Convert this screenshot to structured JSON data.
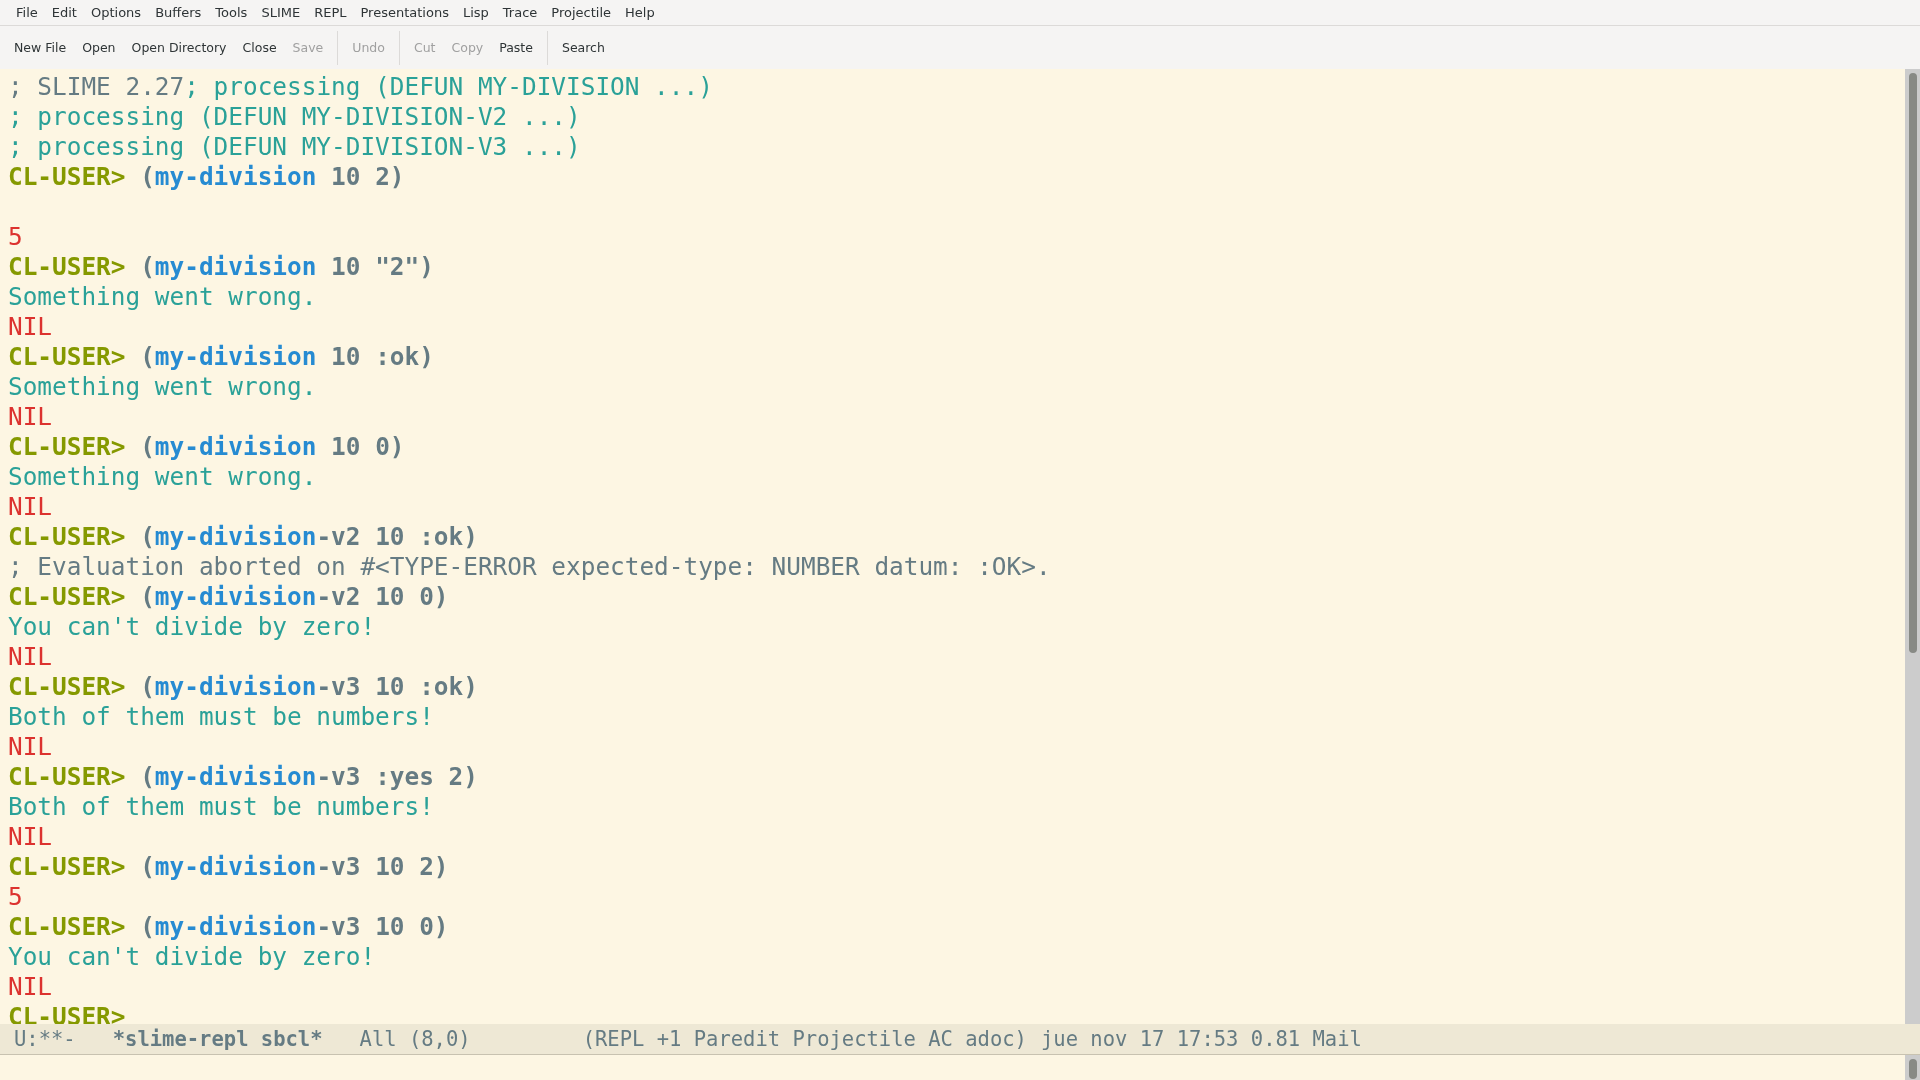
{
  "menu_bar": [
    "File",
    "Edit",
    "Options",
    "Buffers",
    "Tools",
    "SLIME",
    "REPL",
    "Presentations",
    "Lisp",
    "Trace",
    "Projectile",
    "Help"
  ],
  "toolbar": [
    [
      {
        "label": "New File",
        "disabled": false
      },
      {
        "label": "Open",
        "disabled": false
      },
      {
        "label": "Open Directory",
        "disabled": false
      },
      {
        "label": "Close",
        "disabled": false
      },
      {
        "label": "Save",
        "disabled": true
      }
    ],
    [
      {
        "label": "Undo",
        "disabled": true
      }
    ],
    [
      {
        "label": "Cut",
        "disabled": true
      },
      {
        "label": "Copy",
        "disabled": true
      },
      {
        "label": "Paste",
        "disabled": false
      }
    ],
    [
      {
        "label": "Search",
        "disabled": false
      }
    ]
  ],
  "repl_lines": [
    {
      "kind": "output",
      "spans": [
        {
          "kind": "comment",
          "text": "; SLIME 2.27"
        },
        {
          "kind": "message",
          "text": "; processing (DEFUN MY-DIVISION ...)"
        }
      ]
    },
    {
      "kind": "output",
      "spans": [
        {
          "kind": "message",
          "text": "; processing (DEFUN MY-DIVISION-V2 ...)"
        }
      ]
    },
    {
      "kind": "output",
      "spans": [
        {
          "kind": "message",
          "text": "; processing (DEFUN MY-DIVISION-V3 ...)"
        }
      ]
    },
    {
      "kind": "input",
      "spans": [
        {
          "kind": "prompt",
          "text": "CL-USER>"
        },
        {
          "kind": "paren",
          "text": " ("
        },
        {
          "kind": "function",
          "text": "my-division"
        },
        {
          "kind": "code",
          "text": " 10 2)"
        }
      ]
    },
    {
      "kind": "blank"
    },
    {
      "kind": "output",
      "spans": [
        {
          "kind": "value",
          "text": "5"
        }
      ]
    },
    {
      "kind": "input",
      "spans": [
        {
          "kind": "prompt",
          "text": "CL-USER>"
        },
        {
          "kind": "paren",
          "text": " ("
        },
        {
          "kind": "function",
          "text": "my-division"
        },
        {
          "kind": "code",
          "text": " 10 \"2\")"
        }
      ]
    },
    {
      "kind": "output",
      "spans": [
        {
          "kind": "message",
          "text": "Something went wrong."
        }
      ]
    },
    {
      "kind": "output",
      "spans": [
        {
          "kind": "value",
          "text": "NIL"
        }
      ]
    },
    {
      "kind": "input",
      "spans": [
        {
          "kind": "prompt",
          "text": "CL-USER>"
        },
        {
          "kind": "paren",
          "text": " ("
        },
        {
          "kind": "function",
          "text": "my-division"
        },
        {
          "kind": "code",
          "text": " 10 :ok)"
        }
      ]
    },
    {
      "kind": "output",
      "spans": [
        {
          "kind": "message",
          "text": "Something went wrong."
        }
      ]
    },
    {
      "kind": "output",
      "spans": [
        {
          "kind": "value",
          "text": "NIL"
        }
      ]
    },
    {
      "kind": "input",
      "spans": [
        {
          "kind": "prompt",
          "text": "CL-USER>"
        },
        {
          "kind": "paren",
          "text": " ("
        },
        {
          "kind": "function",
          "text": "my-division"
        },
        {
          "kind": "code",
          "text": " 10 0)"
        }
      ]
    },
    {
      "kind": "output",
      "spans": [
        {
          "kind": "message",
          "text": "Something went wrong."
        }
      ]
    },
    {
      "kind": "output",
      "spans": [
        {
          "kind": "value",
          "text": "NIL"
        }
      ]
    },
    {
      "kind": "input",
      "spans": [
        {
          "kind": "prompt",
          "text": "CL-USER>"
        },
        {
          "kind": "paren",
          "text": " ("
        },
        {
          "kind": "function",
          "text": "my-division"
        },
        {
          "kind": "code",
          "text": "-v2 10 :ok)"
        }
      ]
    },
    {
      "kind": "output",
      "spans": [
        {
          "kind": "comment",
          "text": "; Evaluation aborted on #<TYPE-ERROR expected-type: NUMBER datum: :OK>."
        }
      ]
    },
    {
      "kind": "input",
      "spans": [
        {
          "kind": "prompt",
          "text": "CL-USER>"
        },
        {
          "kind": "paren",
          "text": " ("
        },
        {
          "kind": "function",
          "text": "my-division"
        },
        {
          "kind": "code",
          "text": "-v2 10 0)"
        }
      ]
    },
    {
      "kind": "output",
      "spans": [
        {
          "kind": "message",
          "text": "You can't divide by zero!"
        }
      ]
    },
    {
      "kind": "output",
      "spans": [
        {
          "kind": "value",
          "text": "NIL"
        }
      ]
    },
    {
      "kind": "input",
      "spans": [
        {
          "kind": "prompt",
          "text": "CL-USER>"
        },
        {
          "kind": "paren",
          "text": " ("
        },
        {
          "kind": "function",
          "text": "my-division"
        },
        {
          "kind": "code",
          "text": "-v3 10 :ok)"
        }
      ]
    },
    {
      "kind": "output",
      "spans": [
        {
          "kind": "message",
          "text": "Both of them must be numbers!"
        }
      ]
    },
    {
      "kind": "output",
      "spans": [
        {
          "kind": "value",
          "text": "NIL"
        }
      ]
    },
    {
      "kind": "input",
      "spans": [
        {
          "kind": "prompt",
          "text": "CL-USER>"
        },
        {
          "kind": "paren",
          "text": " ("
        },
        {
          "kind": "function",
          "text": "my-division"
        },
        {
          "kind": "code",
          "text": "-v3 :yes 2)"
        }
      ]
    },
    {
      "kind": "output",
      "spans": [
        {
          "kind": "message",
          "text": "Both of them must be numbers!"
        }
      ]
    },
    {
      "kind": "output",
      "spans": [
        {
          "kind": "value",
          "text": "NIL"
        }
      ]
    },
    {
      "kind": "input",
      "spans": [
        {
          "kind": "prompt",
          "text": "CL-USER>"
        },
        {
          "kind": "paren",
          "text": " ("
        },
        {
          "kind": "function",
          "text": "my-division"
        },
        {
          "kind": "code",
          "text": "-v3 10 2)"
        }
      ]
    },
    {
      "kind": "output",
      "spans": [
        {
          "kind": "value",
          "text": "5"
        }
      ]
    },
    {
      "kind": "input",
      "spans": [
        {
          "kind": "prompt",
          "text": "CL-USER>"
        },
        {
          "kind": "paren",
          "text": " ("
        },
        {
          "kind": "function",
          "text": "my-division"
        },
        {
          "kind": "code",
          "text": "-v3 10 0)"
        }
      ]
    },
    {
      "kind": "output",
      "spans": [
        {
          "kind": "message",
          "text": "You can't divide by zero!"
        }
      ]
    },
    {
      "kind": "output",
      "spans": [
        {
          "kind": "value",
          "text": "NIL"
        }
      ]
    },
    {
      "kind": "input",
      "spans": [
        {
          "kind": "prompt",
          "text": "CL-USER>"
        }
      ]
    }
  ],
  "mode_line": {
    "state": "U:**-",
    "buffer_name": "*slime-repl sbcl*",
    "position": "All (8,0)",
    "modes": "(REPL +1 Paredit Projectile AC adoc)",
    "info": "jue nov 17 17:53 0.81 Mail"
  }
}
